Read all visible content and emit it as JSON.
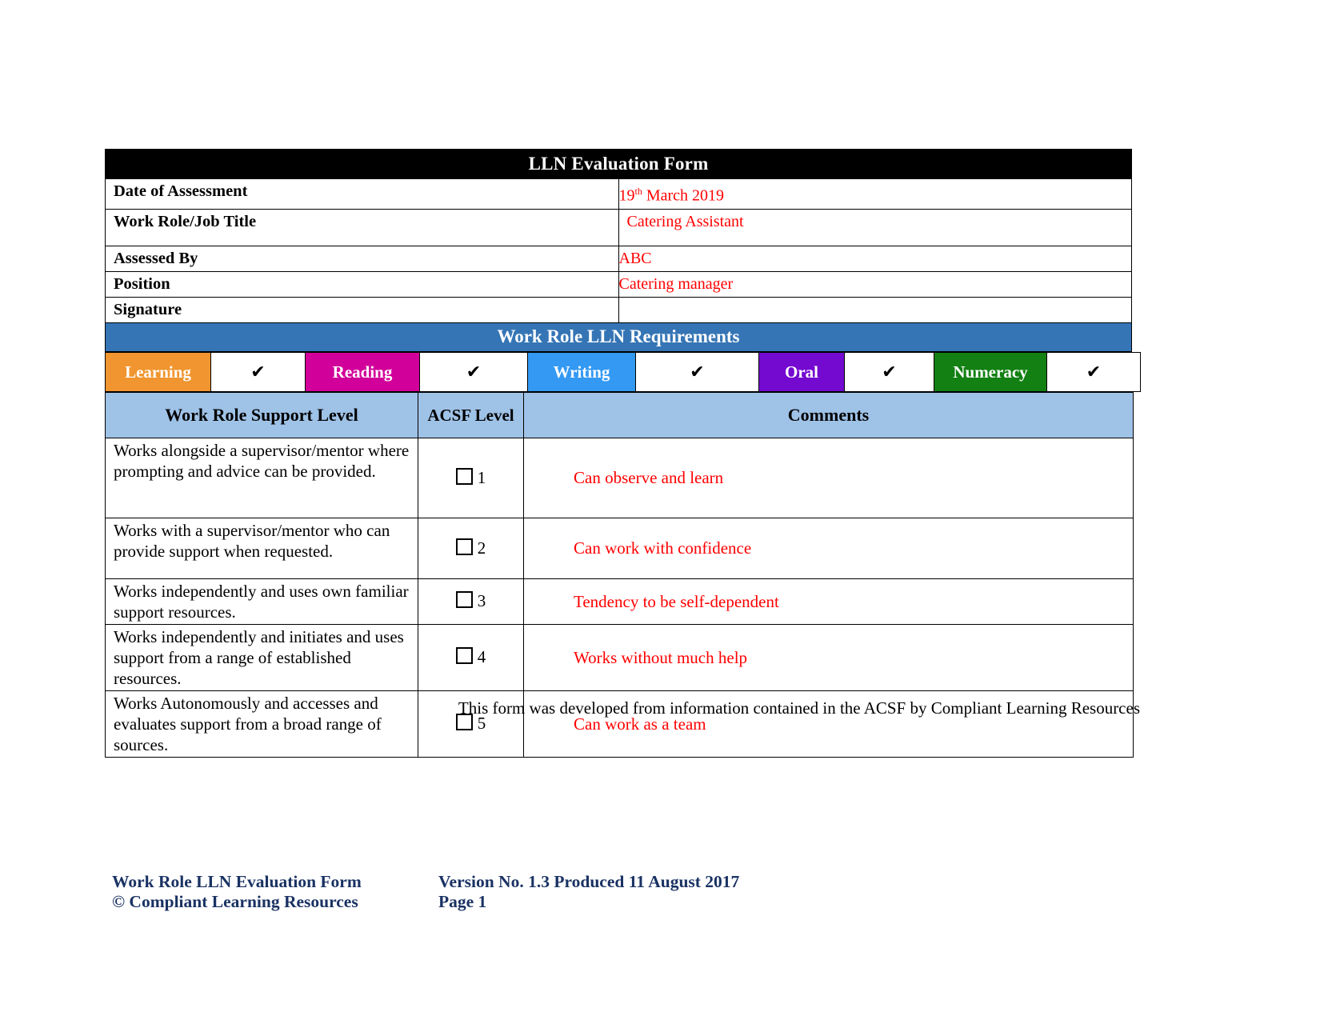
{
  "document": {
    "title": "LLN Evaluation Form"
  },
  "meta": {
    "rows": [
      {
        "label": "Date of Assessment",
        "value": "19",
        "sup": "th",
        "value_rest": " March 2019"
      },
      {
        "label": "Work Role/Job Title",
        "value": "Catering Assistant"
      },
      {
        "label": "Assessed By",
        "value": "ABC"
      },
      {
        "label": "Position",
        "value": "Catering manager"
      },
      {
        "label": "Signature",
        "value": ""
      }
    ]
  },
  "requirements": {
    "section_title": "Work Role LLN Requirements",
    "skills": [
      {
        "name": "Learning",
        "color": "#f0952f",
        "checked": "✔"
      },
      {
        "name": "Reading",
        "color": "#d2009a",
        "checked": "✔"
      },
      {
        "name": "Writing",
        "color": "#3399f3",
        "checked": "✔"
      },
      {
        "name": "Oral",
        "color": "#7409d0",
        "checked": "✔"
      },
      {
        "name": "Numeracy",
        "color": "#128012",
        "checked": "✔"
      }
    ]
  },
  "levels_table": {
    "headers": {
      "support_level": "Work Role Support Level",
      "acsf_level": "ACSF Level",
      "comments": "Comments"
    },
    "rows": [
      {
        "description": "Works alongside a supervisor/mentor where prompting and advice can be provided.",
        "acsf": "1",
        "comment": "Can observe and learn"
      },
      {
        "description": "Works with a supervisor/mentor who can provide support when requested.",
        "acsf": "2",
        "comment": "Can work with confidence"
      },
      {
        "description": "Works independently and uses own familiar support resources.",
        "acsf": "3",
        "comment": "Tendency to be self-dependent"
      },
      {
        "description": "Works independently and initiates and uses support from a range of established resources.",
        "acsf": "4",
        "comment": "Works without much help"
      },
      {
        "description": "Works Autonomously and accesses and evaluates support from a broad range of sources.",
        "acsf": "5",
        "comment": "Can work as a team"
      }
    ]
  },
  "note": "This form was developed from information contained in the ACSF by Compliant Learning Resources",
  "footer": {
    "line1_left": "Work Role LLN Evaluation Form",
    "line1_right": "Version No. 1.3 Produced 11 August 2017",
    "line2_left": "© Compliant Learning Resources",
    "line2_right": "Page 1"
  },
  "colors": {
    "title_bar_bg": "#000000",
    "section_bar_bg": "#3575b5",
    "table_header_bg": "#9fc2e7",
    "entry_text": "#ff0000",
    "footer_text": "#1a3263"
  }
}
